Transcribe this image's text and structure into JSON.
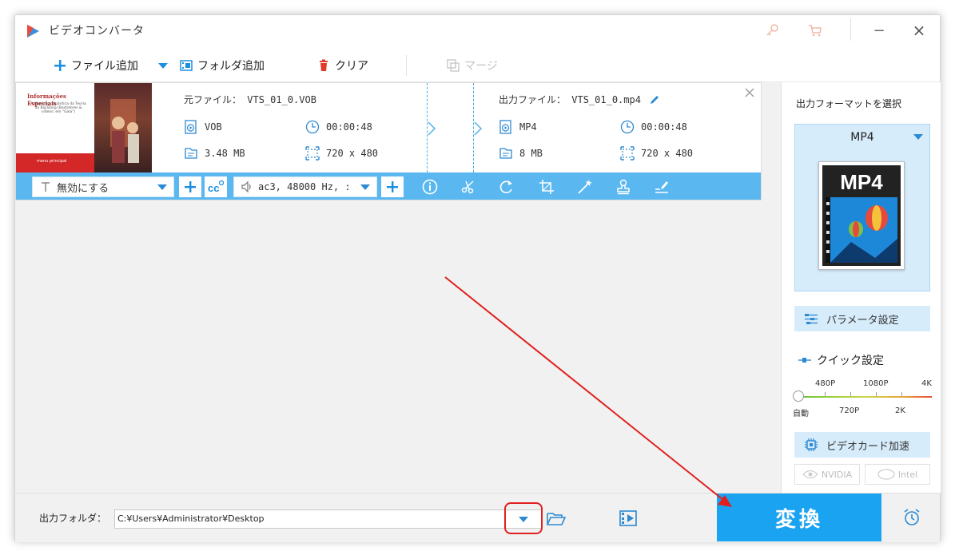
{
  "app": {
    "title": "ビデオコンバータ"
  },
  "window_controls": {
    "minimize": "−",
    "close": "×"
  },
  "toolbar": {
    "add_file": "ファイル追加",
    "add_folder": "フォルダ追加",
    "clear": "クリア",
    "merge": "マージ"
  },
  "file": {
    "source_label": "元ファイル：",
    "source_name": "VTS_01_0.VOB",
    "source_format": "VOB",
    "source_duration": "00:00:48",
    "source_size": "3.48 MB",
    "source_resolution": "720 x 480",
    "output_label": "出力ファイル：",
    "output_name": "VTS_01_0.mp4",
    "output_format": "MP4",
    "output_duration": "00:00:48",
    "output_size": "8 MB",
    "output_resolution": "720 x 480",
    "thumb_title": "Informações Especiais",
    "thumb_subtitle": "A Mecânica Quântica da Teoria do Big Bang (Bastidores & vídeos: em \"Gala\")",
    "thumb_menu": "menu principal"
  },
  "card_bar": {
    "subtitle_value": "無効にする",
    "audio_value": "ac3, 48000 Hz, :"
  },
  "right_panel": {
    "select_format_title": "出力フォーマットを選択",
    "format_name": "MP4",
    "format_image_text": "MP4",
    "param_settings": "パラメータ設定",
    "quick_settings": "クイック設定",
    "quality_top_labels": [
      "480P",
      "1080P",
      "4K"
    ],
    "quality_bottom_labels": [
      "自動",
      "720P",
      "2K"
    ],
    "quality_level": 0,
    "gpu_accel": "ビデオカード加速",
    "vendors": [
      "NVIDIA",
      "Intel"
    ]
  },
  "bottom": {
    "output_folder_label": "出力フォルダ：",
    "output_path": "C:¥Users¥Administrator¥Desktop",
    "convert": "変換"
  },
  "colors": {
    "accent": "#1aa3f0",
    "bar": "#5ab7f0",
    "highlight": "#e0201e",
    "panel_blue": "#d6ecfb"
  }
}
